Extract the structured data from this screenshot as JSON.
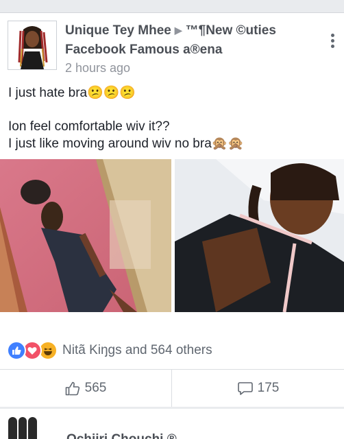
{
  "post": {
    "author": "Unique Tey Mhee",
    "group_line1": "™¶New ©uties",
    "group_line2": "Facebook Famous a®ena",
    "time": "2 hours ago",
    "text_lines": [
      "I just hate bra😕😕😕",
      "Ion feel comfortable wiv it??",
      "I just like moving around wiv no bra🙊🙊"
    ],
    "reaction_summary": "Nitã Kiŋgs and 564 others",
    "like_count": "565",
    "comment_count": "175"
  },
  "icons": {
    "arrow": "▶",
    "more": "vertical-dots-icon",
    "like": "thumbs-up-icon",
    "comment": "speech-bubble-icon"
  },
  "colors": {
    "like_blue": "#4080ff",
    "love_red": "#f25268",
    "haha_yellow": "#f7b125",
    "name_gray": "#4b4f56",
    "meta_gray": "#90949c"
  },
  "next_post": {
    "name_partial": "Ochiiri Chouchi ®..."
  }
}
